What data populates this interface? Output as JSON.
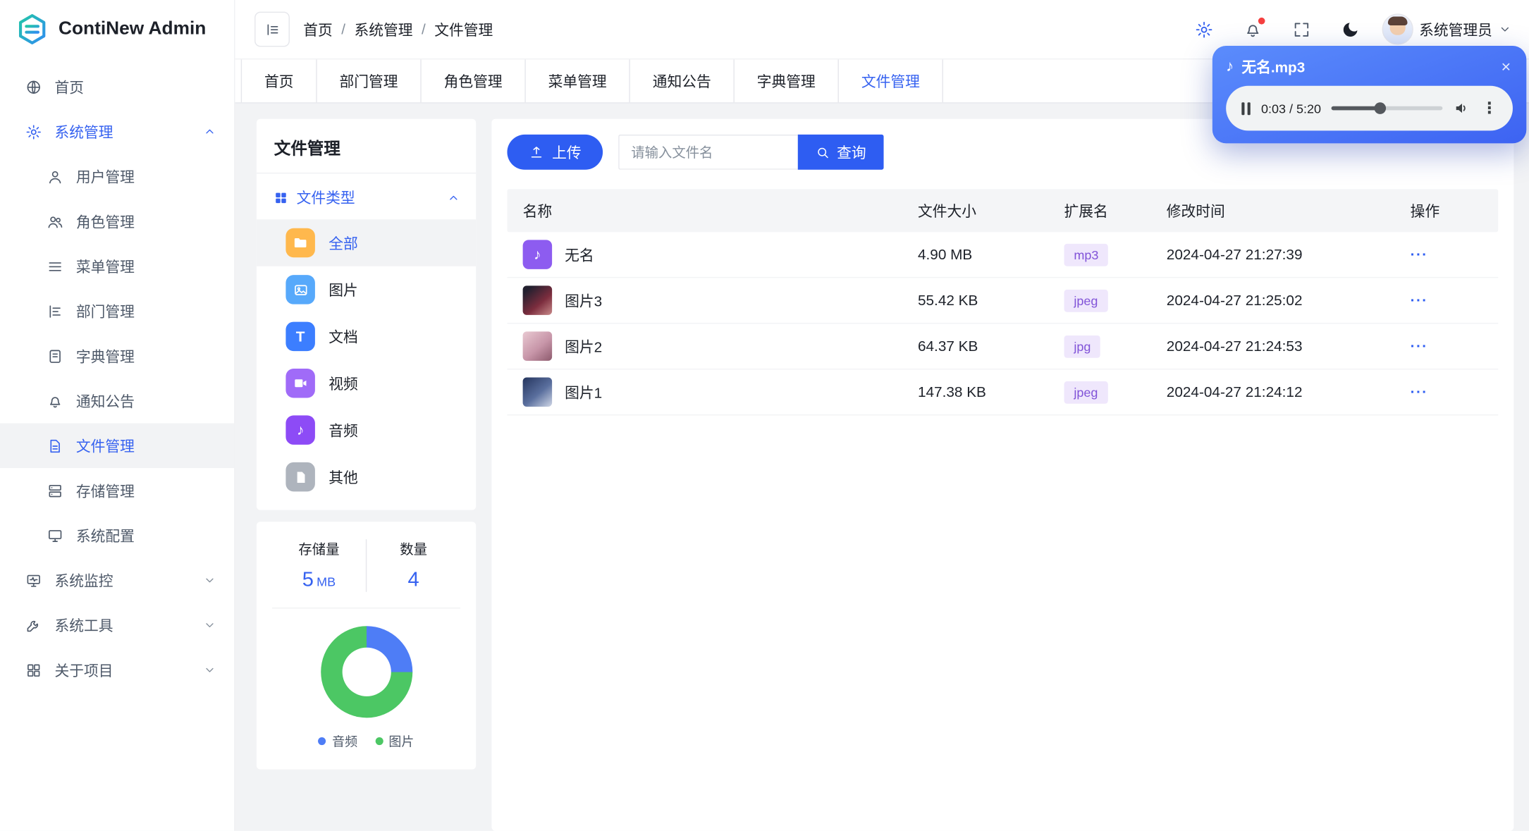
{
  "app": {
    "name": "ContiNew Admin"
  },
  "header": {
    "breadcrumb": [
      "首页",
      "系统管理",
      "文件管理"
    ],
    "separator": "/",
    "user_name": "系统管理员"
  },
  "tabs": {
    "items": [
      "首页",
      "部门管理",
      "角色管理",
      "菜单管理",
      "通知公告",
      "字典管理",
      "文件管理"
    ],
    "active": "文件管理"
  },
  "sidebar": {
    "items": [
      "首页",
      "系统管理",
      "系统监控",
      "系统工具",
      "关于项目"
    ],
    "system_children": [
      "用户管理",
      "角色管理",
      "菜单管理",
      "部门管理",
      "字典管理",
      "通知公告",
      "文件管理",
      "存储管理",
      "系统配置"
    ],
    "active_item": "文件管理"
  },
  "file_panel": {
    "title": "文件管理",
    "group_label": "文件类型",
    "types": [
      {
        "label": "全部",
        "active": true
      },
      {
        "label": "图片",
        "active": false
      },
      {
        "label": "文档",
        "active": false
      },
      {
        "label": "视频",
        "active": false
      },
      {
        "label": "音频",
        "active": false
      },
      {
        "label": "其他",
        "active": false
      }
    ]
  },
  "stats": {
    "storage_label": "存储量",
    "storage_value": "5",
    "storage_unit": "MB",
    "count_label": "数量",
    "count_value": "4"
  },
  "chart_data": {
    "type": "pie",
    "labels": [
      "音频",
      "图片"
    ],
    "values": [
      1,
      3
    ],
    "colors": [
      "#4e7df6",
      "#4cc764"
    ],
    "legend_position": "bottom"
  },
  "toolbar": {
    "upload_label": "上传",
    "search_placeholder": "请输入文件名",
    "search_value": "",
    "query_label": "查询"
  },
  "table": {
    "columns": [
      "名称",
      "文件大小",
      "扩展名",
      "修改时间",
      "操作"
    ],
    "rows": [
      {
        "name": "无名",
        "size": "4.90 MB",
        "ext": "mp3",
        "time": "2024-04-27 21:27:39"
      },
      {
        "name": "图片3",
        "size": "55.42 KB",
        "ext": "jpeg",
        "time": "2024-04-27 21:25:02"
      },
      {
        "name": "图片2",
        "size": "64.37 KB",
        "ext": "jpg",
        "time": "2024-04-27 21:24:53"
      },
      {
        "name": "图片1",
        "size": "147.38 KB",
        "ext": "jpeg",
        "time": "2024-04-27 21:24:12"
      }
    ],
    "actions_glyph": "···"
  },
  "player": {
    "title": "无名.mp3",
    "time_display": "0:03 / 5:20",
    "close_glyph": "×",
    "menu_glyph": "⋮"
  },
  "colors": {
    "primary": "#2e5df2",
    "chart_blue": "#4e7df6",
    "chart_green": "#4cc764",
    "tag_bg": "#efe7fc",
    "tag_text": "#8153d8",
    "notification_dot": "#f53f3f"
  }
}
